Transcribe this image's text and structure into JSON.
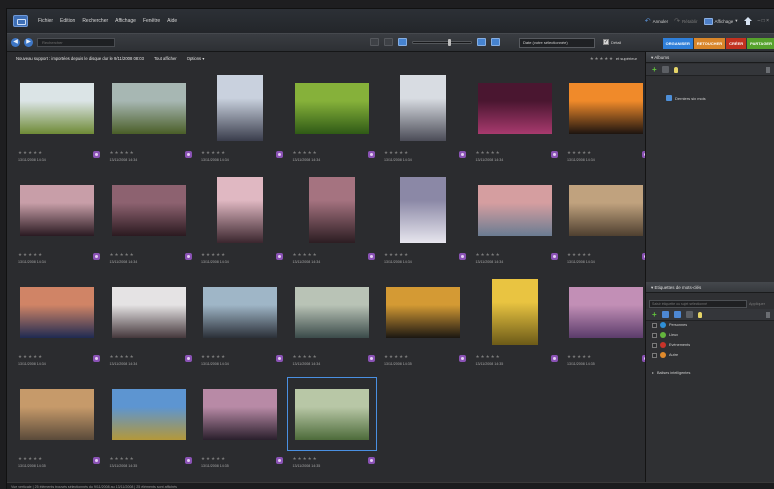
{
  "menu": {
    "items": [
      "Fichier",
      "Edition",
      "Rechercher",
      "Affichage",
      "Fenêtre",
      "Aide"
    ]
  },
  "header_right": {
    "undo_label": "Annuler",
    "redo_label": "Rétablir",
    "display_label": "Affichage",
    "window_controls": "– □ ×"
  },
  "toolbar": {
    "back_glyph": "◀",
    "forward_glyph": "▶",
    "search_value": "Rechercher",
    "sort_value": "Date (votre sélectionnée)",
    "details_label": "Détail",
    "details_checked": "✓",
    "zoom_level": 0.62,
    "modes": [
      {
        "label": "ORGANISER",
        "color": "#2f7fd9"
      },
      {
        "label": "RETOUCHER",
        "color": "#d9862a"
      },
      {
        "label": "CRÉER",
        "color": "#c2321f"
      },
      {
        "label": "PARTAGER",
        "color": "#56a22c"
      }
    ]
  },
  "content": {
    "source_label": "Nouveau support : importées depuis le disque dur le 9/11/2008 08:03",
    "show_all_label": "Tout afficher",
    "options_label": "Options ▾",
    "rating_stars": "★★★★★",
    "rating_mode": "et supérieur"
  },
  "photos": [
    {
      "stars": "★★★★★",
      "date": "13/11/2008 14:34",
      "c1": "#dbe4e6",
      "c2": "#6e8a36",
      "w": 74,
      "h": 51
    },
    {
      "stars": "★★★★★",
      "date": "13/11/2008 14:34",
      "c1": "#a7b7b3",
      "c2": "#4a5e28",
      "w": 74,
      "h": 51
    },
    {
      "stars": "★★★★★",
      "date": "13/11/2008 14:34",
      "c1": "#c9d1de",
      "c2": "#3a3d4c",
      "w": 46,
      "h": 66
    },
    {
      "stars": "★★★★★",
      "date": "13/11/2008 14:34",
      "c1": "#86b13a",
      "c2": "#2f5a16",
      "w": 74,
      "h": 51
    },
    {
      "stars": "★★★★★",
      "date": "13/11/2008 14:34",
      "c1": "#d8dce2",
      "c2": "#4b4c57",
      "w": 46,
      "h": 66
    },
    {
      "stars": "★★★★★",
      "date": "13/11/2008 14:34",
      "c1": "#4a1630",
      "c2": "#a83a6e",
      "w": 74,
      "h": 51
    },
    {
      "stars": "★★★★★",
      "date": "13/11/2008 14:34",
      "c1": "#f08a2a",
      "c2": "#1d1410",
      "w": 74,
      "h": 51
    },
    {
      "stars": "★★★★★",
      "date": "13/11/2008 14:34",
      "c1": "#c89ea8",
      "c2": "#2a1a22",
      "w": 74,
      "h": 51
    },
    {
      "stars": "★★★★★",
      "date": "13/11/2008 14:34",
      "c1": "#8d6270",
      "c2": "#2b1a20",
      "w": 74,
      "h": 51
    },
    {
      "stars": "★★★★★",
      "date": "13/11/2008 14:34",
      "c1": "#e0b8c2",
      "c2": "#3b262e",
      "w": 46,
      "h": 66
    },
    {
      "stars": "★★★★★",
      "date": "13/11/2008 14:34",
      "c1": "#a57380",
      "c2": "#2c1d22",
      "w": 46,
      "h": 66
    },
    {
      "stars": "★★★★★",
      "date": "13/11/2008 14:34",
      "c1": "#8b88a6",
      "c2": "#e7e6ee",
      "w": 46,
      "h": 66
    },
    {
      "stars": "★★★★★",
      "date": "13/11/2008 14:34",
      "c1": "#d59ea0",
      "c2": "#6a7c92",
      "w": 74,
      "h": 51
    },
    {
      "stars": "★★★★★",
      "date": "13/11/2008 14:34",
      "c1": "#c0a27e",
      "c2": "#4f4030",
      "w": 74,
      "h": 51
    },
    {
      "stars": "★★★★★",
      "date": "13/11/2008 14:34",
      "c1": "#d08466",
      "c2": "#1f2a52",
      "w": 74,
      "h": 51
    },
    {
      "stars": "★★★★★",
      "date": "13/11/2008 14:34",
      "c1": "#e5e3e4",
      "c2": "#45383c",
      "w": 74,
      "h": 51
    },
    {
      "stars": "★★★★★",
      "date": "13/11/2008 14:34",
      "c1": "#9fb6c7",
      "c2": "#2b3038",
      "w": 74,
      "h": 51
    },
    {
      "stars": "★★★★★",
      "date": "13/11/2008 14:34",
      "c1": "#b9c3b6",
      "c2": "#3b4b4a",
      "w": 74,
      "h": 51
    },
    {
      "stars": "★★★★★",
      "date": "13/11/2008 14:35",
      "c1": "#d49a34",
      "c2": "#1b1712",
      "w": 74,
      "h": 51
    },
    {
      "stars": "★★★★★",
      "date": "13/11/2008 14:35",
      "c1": "#e9c441",
      "c2": "#6c5a18",
      "w": 46,
      "h": 66
    },
    {
      "stars": "★★★★★",
      "date": "13/11/2008 14:35",
      "c1": "#c28fb6",
      "c2": "#5b3c6b",
      "w": 74,
      "h": 51
    },
    {
      "stars": "★★★★★",
      "date": "13/11/2008 14:35",
      "c1": "#c69a6a",
      "c2": "#5a4a3a",
      "w": 74,
      "h": 51
    },
    {
      "stars": "★★★★★",
      "date": "13/11/2008 14:35",
      "c1": "#5d95d1",
      "c2": "#b4983a",
      "w": 74,
      "h": 51
    },
    {
      "stars": "★★★★★",
      "date": "13/11/2008 14:35",
      "c1": "#b88aa6",
      "c2": "#2a1f2c",
      "w": 74,
      "h": 51
    },
    {
      "stars": "★★★★★",
      "date": "13/11/2008 14:35",
      "c1": "#b8c7a6",
      "c2": "#4d6b3a",
      "w": 74,
      "h": 51
    }
  ],
  "selected_photo": 24,
  "albums": {
    "title": "▾ Albums",
    "items": [
      {
        "label": "Derniers six mois"
      }
    ]
  },
  "tags": {
    "title": "▾ Etiquettes de mots-clés",
    "search_placeholder": "Saisir étiquette ou sujet sélectionné",
    "apply_label": "Appliquer",
    "items": [
      {
        "label": "Personnes",
        "color": "#2f8fd6"
      },
      {
        "label": "Lieux",
        "color": "#64b53d"
      },
      {
        "label": "Evénements",
        "color": "#c7342a"
      },
      {
        "label": "Autre",
        "color": "#e08a2c"
      }
    ],
    "smart_label": "Balises intelligentes"
  },
  "status": {
    "text": "Vue verticale  |  25 éléments trouvés sélectionnés du 9/11/2008 au 13/11/2008  |  25 éléments sont affichés"
  }
}
